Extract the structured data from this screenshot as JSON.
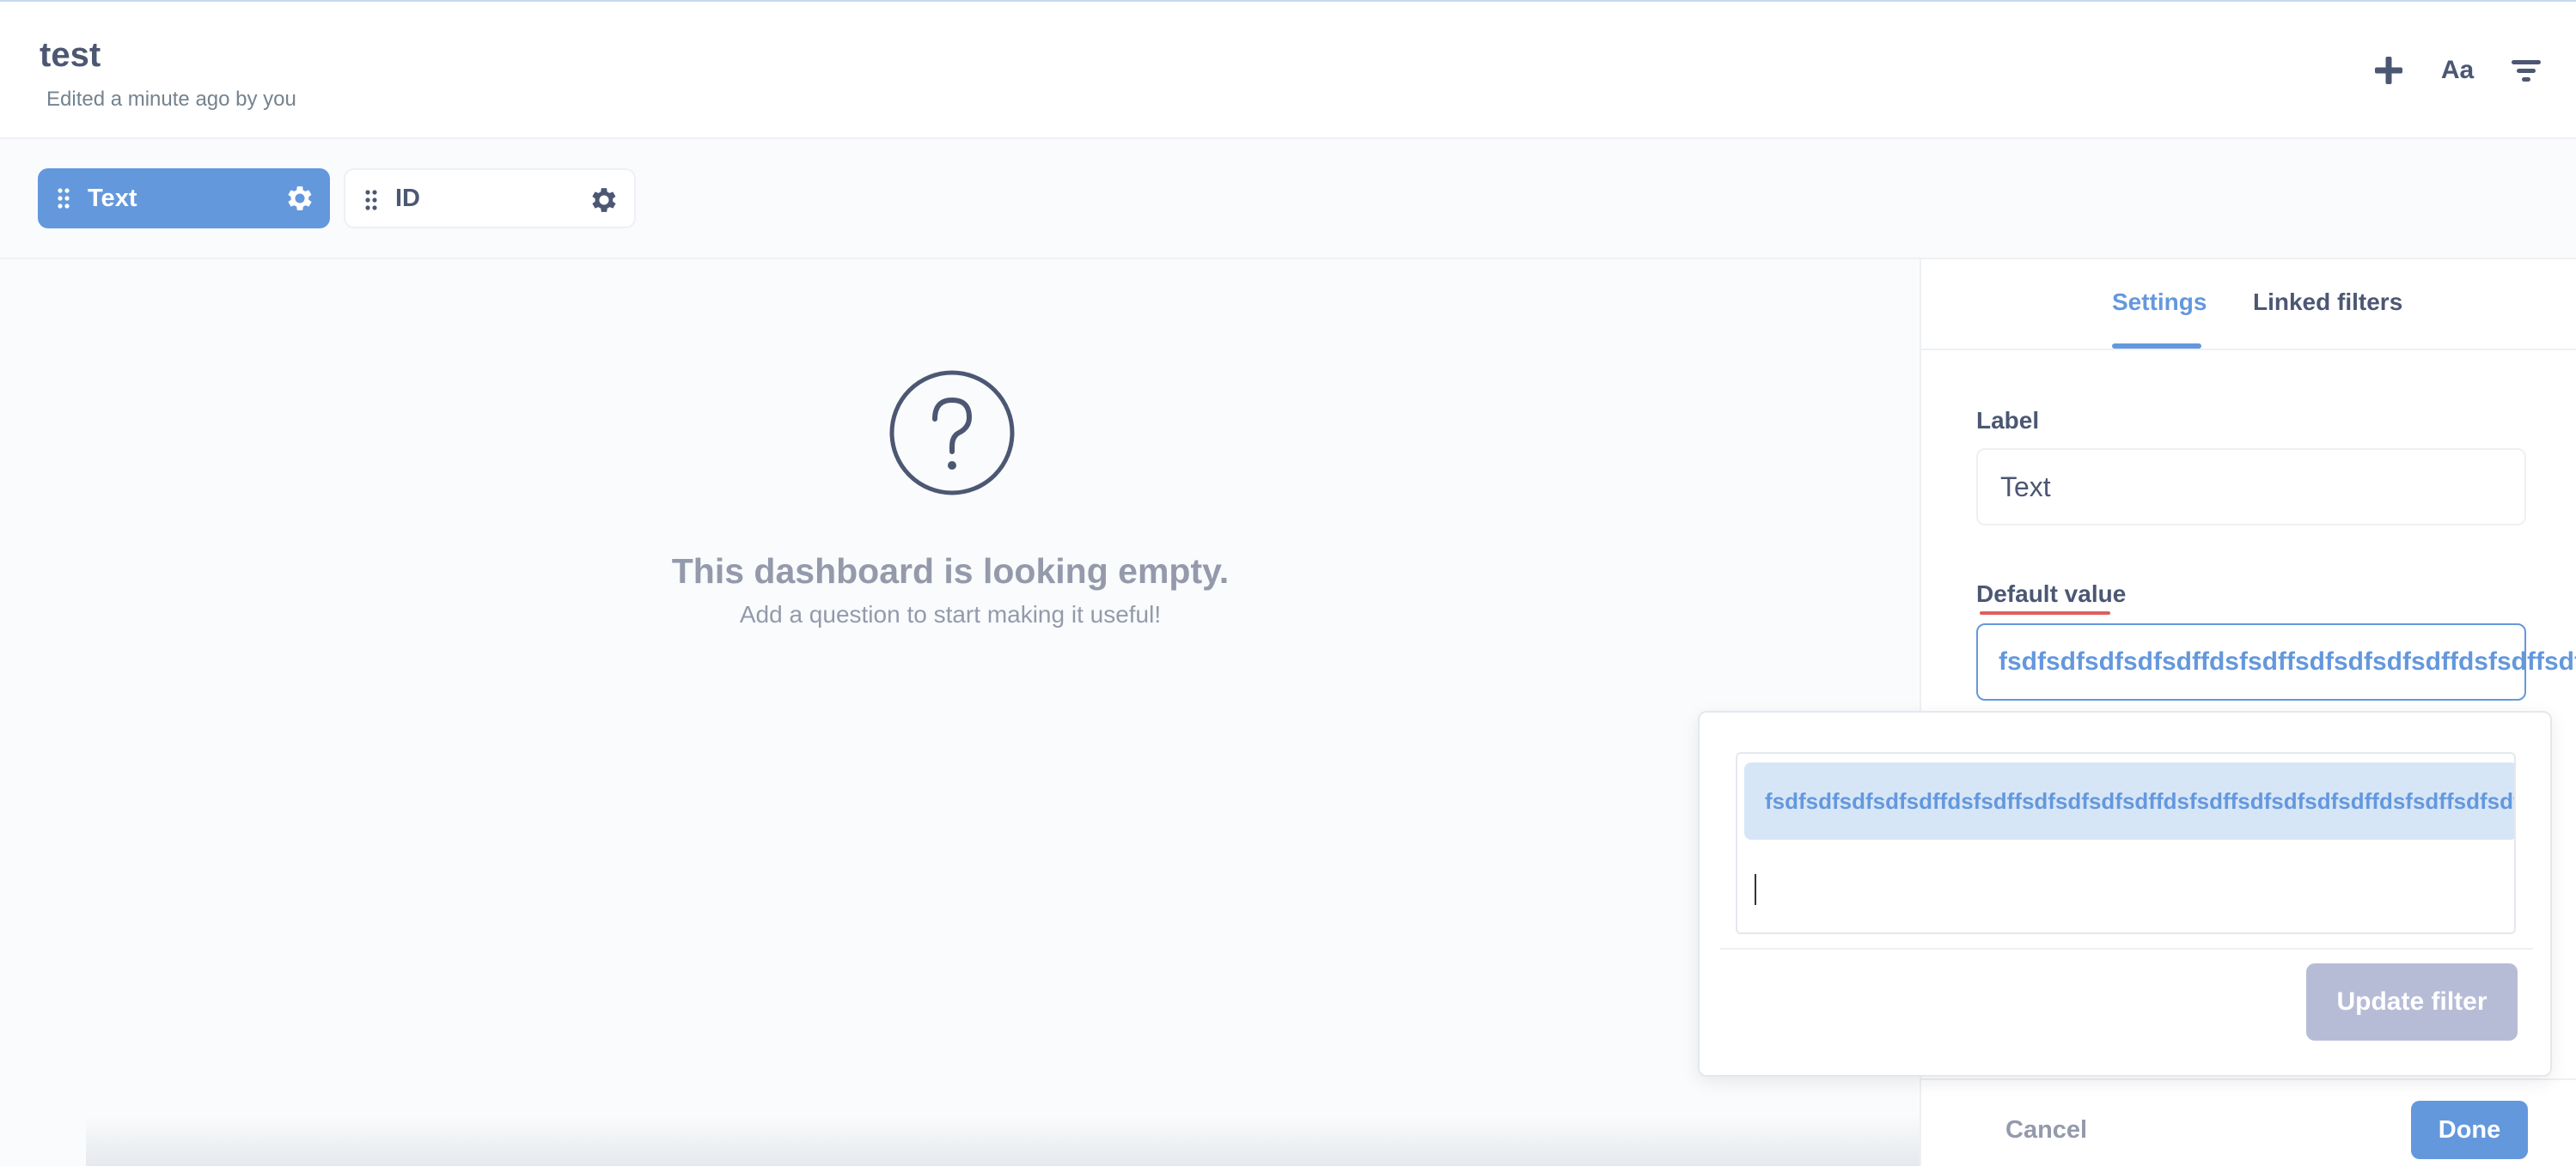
{
  "header": {
    "title": "test",
    "subtitle": "Edited a minute ago by you",
    "add_icon": "plus-icon",
    "text_icon": "Aa",
    "filter_icon": "filter-icon"
  },
  "filters": [
    {
      "label": "Text",
      "active": true
    },
    {
      "label": "ID",
      "active": false
    }
  ],
  "empty_state": {
    "icon": "question-circle-icon",
    "title": "This dashboard is looking empty.",
    "subtitle": "Add a question to start making it useful!"
  },
  "sidebar": {
    "tabs": [
      {
        "label": "Settings",
        "active": true
      },
      {
        "label": "Linked filters",
        "active": false
      }
    ],
    "label_field": {
      "label": "Label",
      "value": "Text"
    },
    "default_value": {
      "label": "Default value",
      "value": "fsdfsdfsdfsdfsdffdsfsdffsdfsdfsdfsdffdsfsdffsdfsdfsdfsdffdsfsdffsdfsdfsdfsdffdsfsdff"
    },
    "cancel_label": "Cancel",
    "done_label": "Done"
  },
  "popover": {
    "token_value": "fsdfsdfsdfsdfsdffdsfsdffsdfsdfsdfsdffdsfsdffsdfsdfsdfsdffdsfsdffsdfsdfsdfsdffdsfsdff",
    "update_label": "Update filter"
  },
  "colors": {
    "brand": "#6498dd",
    "text_dark": "#4c5773",
    "text_muted": "#949aab",
    "token_bg": "#d7e6f7",
    "disabled_button": "#b7bcd6",
    "error_underline": "#e05e5e"
  }
}
